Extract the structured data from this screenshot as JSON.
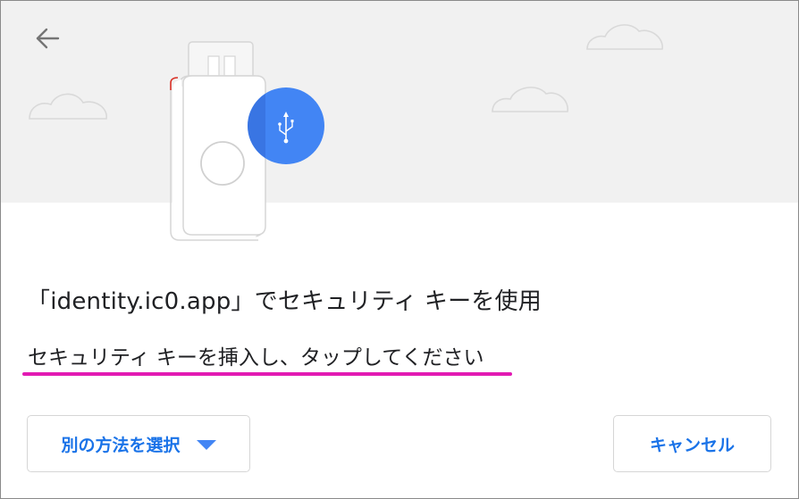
{
  "dialog": {
    "title": "「identity.ic0.app」でセキュリティ キーを使用",
    "instruction": "セキュリティ キーを挿入し、タップしてください",
    "other_method_label": "別の方法を選択",
    "cancel_label": "キャンセル"
  },
  "icons": {
    "back": "arrow-back-icon",
    "usb": "usb-icon",
    "dropdown": "caret-down-icon"
  },
  "colors": {
    "accent": "#1a73e8",
    "usb_badge": "#4285f4",
    "highlight_underline": "#e21ab3",
    "illustration_bg": "#f1f1f1"
  }
}
